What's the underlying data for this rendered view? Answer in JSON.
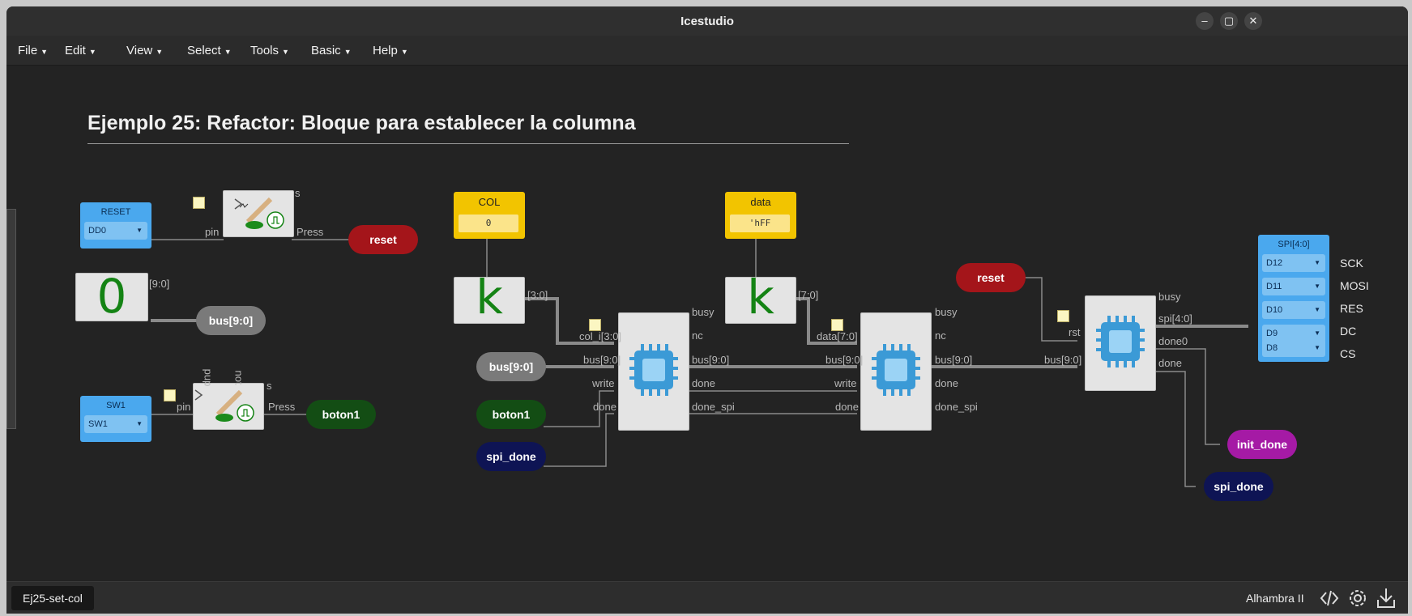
{
  "window": {
    "title": "Icestudio",
    "minimize": "–",
    "maximize": "▢",
    "close": "✕"
  },
  "menu": [
    "File",
    "Edit",
    "View",
    "Select",
    "Tools",
    "Basic",
    "Help"
  ],
  "canvas": {
    "heading": "Ejemplo 25: Refactor: Bloque para establecer la columna",
    "reset_block": {
      "name": "RESET",
      "pin": "DD0",
      "pin_label": "pin",
      "s_label": "s",
      "press_label": "Press",
      "out": "reset"
    },
    "const_zero": {
      "value": "0",
      "port": "[9:0]",
      "out": "bus[9:0]"
    },
    "sw1_block": {
      "name": "SW1",
      "pin": "SW1",
      "pin_label": "pin",
      "pup_label": "pup",
      "not_label": "not",
      "s_label": "s",
      "press_label": "Press",
      "out": "boton1"
    },
    "col_const": {
      "name": "COL",
      "value": "0",
      "k": "k",
      "port": "[3:0]"
    },
    "data_const": {
      "name": "data",
      "value": "'hFF",
      "k": "k",
      "port": "[7:0]"
    },
    "inputs": {
      "bus": "bus[9:0]",
      "boton1": "boton1",
      "spi_done": "spi_done"
    },
    "block1": {
      "in": [
        "col_i[3:0]",
        "bus[9:0]",
        "write",
        "done"
      ],
      "out": [
        "busy",
        "nc",
        "bus[9:0]",
        "done",
        "done_spi"
      ]
    },
    "block2": {
      "in": [
        "data[7:0]",
        "bus[9:0]",
        "write",
        "done"
      ],
      "out": [
        "busy",
        "nc",
        "bus[9:0]",
        "done",
        "done_spi"
      ]
    },
    "block3": {
      "in_reset": "reset",
      "in": [
        "rst",
        "bus[9:0]"
      ],
      "out": [
        "busy",
        "spi[4:0]",
        "done0",
        "done"
      ]
    },
    "spi_block": {
      "name": "SPI[4:0]",
      "pins": [
        "D12",
        "D11",
        "D10",
        "D9",
        "D8"
      ],
      "signals": [
        "SCK",
        "MOSI",
        "RES",
        "DC",
        "CS"
      ]
    },
    "outputs": {
      "init_done": "init_done",
      "spi_done": "spi_done"
    }
  },
  "status": {
    "tab": "Ej25-set-col",
    "board": "Alhambra II",
    "icons": [
      "code-icon",
      "settings-icon",
      "download-icon"
    ]
  },
  "colors": {
    "bg": "#232323",
    "pin_blue": "#4aa8ee",
    "const_yellow": "#f2c400",
    "reset_red": "#a4151a",
    "boton_green": "#134d14",
    "spi_navy": "#0e1454",
    "init_purple": "#a51aa5",
    "bus_grey": "#7a7a7a"
  }
}
